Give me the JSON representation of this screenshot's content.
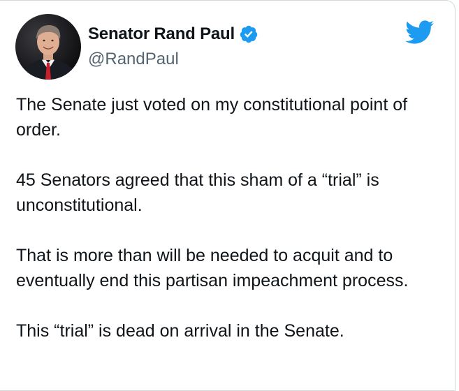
{
  "author": {
    "display_name": "Senator Rand Paul",
    "handle": "@RandPaul",
    "verified": true,
    "avatar_icon": "profile-photo",
    "verified_icon": "verified-badge-icon"
  },
  "brand": {
    "icon": "twitter-bird-icon",
    "color": "#1d9bf0"
  },
  "tweet": {
    "paragraphs": [
      "The Senate just voted on my constitutional point of order.",
      "45 Senators agreed that this sham of a “trial” is unconstitutional.",
      "That is more than will be needed to acquit and to eventually end this partisan impeachment process.",
      "This “trial” is dead on arrival in the Senate."
    ]
  },
  "colors": {
    "text_primary": "#0f1419",
    "text_secondary": "#536471",
    "border": "#cfd9de"
  }
}
